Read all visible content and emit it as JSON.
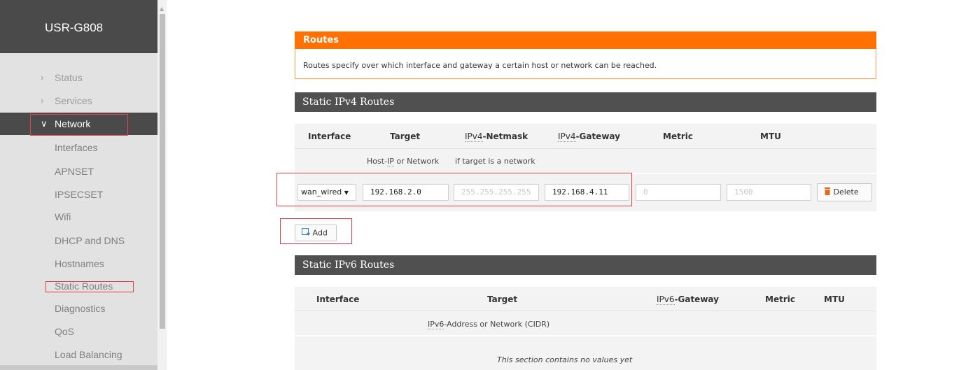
{
  "app": {
    "brand": "USR-G808"
  },
  "sidebar": {
    "menu": [
      {
        "label": "Status",
        "expanded": false
      },
      {
        "label": "Services",
        "expanded": false
      },
      {
        "label": "Network",
        "expanded": true
      }
    ],
    "sub_items": [
      "Interfaces",
      "APNSET",
      "IPSECSET",
      "Wifi",
      "DHCP and DNS",
      "Hostnames",
      "Static Routes",
      "Diagnostics",
      "QoS",
      "Load Balancing"
    ],
    "icons": {
      "collapsed": "chevron-right-icon",
      "expanded": "chevron-down-icon"
    }
  },
  "routes": {
    "title": "Routes",
    "description": "Routes specify over which interface and gateway a certain host or network can be reached."
  },
  "ipv4": {
    "title": "Static IPv4 Routes",
    "headers": {
      "interface": "Interface",
      "target": "Target",
      "netmask_prefix": "IPv4",
      "netmask_suffix": "-Netmask",
      "gateway_prefix": "IPv4",
      "gateway_suffix": "-Gateway",
      "metric": "Metric",
      "mtu": "MTU"
    },
    "hints": {
      "target_a": "Host-",
      "target_ip": "IP",
      "target_b": " or Network",
      "netmask": "if target is a network"
    },
    "row": {
      "interface": "wan_wired",
      "target": "192.168.2.0",
      "netmask_placeholder": "255.255.255.255",
      "gateway": "192.168.4.11",
      "metric_placeholder": "0",
      "mtu_placeholder": "1500",
      "delete_label": "Delete"
    },
    "add_label": "Add"
  },
  "ipv6": {
    "title": "Static IPv6 Routes",
    "headers": {
      "interface": "Interface",
      "target": "Target",
      "gateway_prefix": "IPv6",
      "gateway_suffix": "-Gateway",
      "metric": "Metric",
      "mtu": "MTU"
    },
    "hints": {
      "target_prefix": "IPv6",
      "target_suffix": "-Address or Network (CIDR)"
    },
    "empty": "This section contains no values yet"
  },
  "colors": {
    "accent": "#ff7102",
    "dark": "#4a4a4a",
    "highlight": "#e2434a"
  }
}
